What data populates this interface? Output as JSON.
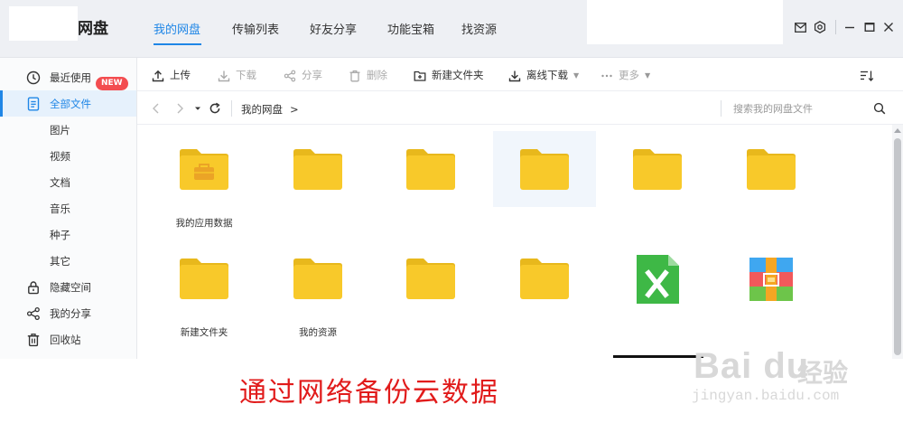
{
  "app": {
    "title": "网盘",
    "nav_tabs": [
      {
        "label": "我的网盘",
        "active": true
      },
      {
        "label": "传输列表",
        "active": false
      },
      {
        "label": "好友分享",
        "active": false
      },
      {
        "label": "功能宝箱",
        "active": false
      },
      {
        "label": "找资源",
        "active": false
      }
    ],
    "window_icons": [
      "mail-icon",
      "settings-icon",
      "minimize-icon",
      "maximize-icon",
      "close-icon"
    ],
    "accent_color": "#1f86e6"
  },
  "sidebar": {
    "items": [
      {
        "label": "最近使用",
        "icon": "clock-icon",
        "badge": "NEW"
      },
      {
        "label": "全部文件",
        "icon": "document-icon",
        "active": true
      },
      {
        "label": "图片"
      },
      {
        "label": "视频"
      },
      {
        "label": "文档"
      },
      {
        "label": "音乐"
      },
      {
        "label": "种子"
      },
      {
        "label": "其它"
      },
      {
        "label": "隐藏空间",
        "icon": "lock-icon"
      },
      {
        "label": "我的分享",
        "icon": "share-icon"
      },
      {
        "label": "回收站",
        "icon": "trash-icon"
      }
    ],
    "badge_color": "#f34d50"
  },
  "toolbar": {
    "upload": "上传",
    "download": "下载",
    "share": "分享",
    "delete": "删除",
    "new_folder": "新建文件夹",
    "offline_download": "离线下载",
    "more": "更多"
  },
  "addressbar": {
    "breadcrumb": "我的网盘",
    "breadcrumb_sep": ">",
    "search_placeholder": "搜索我的网盘文件"
  },
  "files": [
    {
      "name": "我的应用数据",
      "type": "folder-app"
    },
    {
      "name": "",
      "type": "folder"
    },
    {
      "name": "",
      "type": "folder"
    },
    {
      "name": "",
      "type": "folder",
      "hover": true
    },
    {
      "name": "",
      "type": "folder"
    },
    {
      "name": "",
      "type": "folder"
    },
    {
      "name": "新建文件夹",
      "type": "folder"
    },
    {
      "name": "我的资源",
      "type": "folder"
    },
    {
      "name": "",
      "type": "folder"
    },
    {
      "name": "",
      "type": "folder"
    },
    {
      "name": "",
      "type": "excel"
    },
    {
      "name": "",
      "type": "archive"
    }
  ],
  "caption": "通过网络备份云数据",
  "watermark": {
    "logo": "Bai du",
    "cn": "经验",
    "url": "jingyan.baidu.com"
  }
}
